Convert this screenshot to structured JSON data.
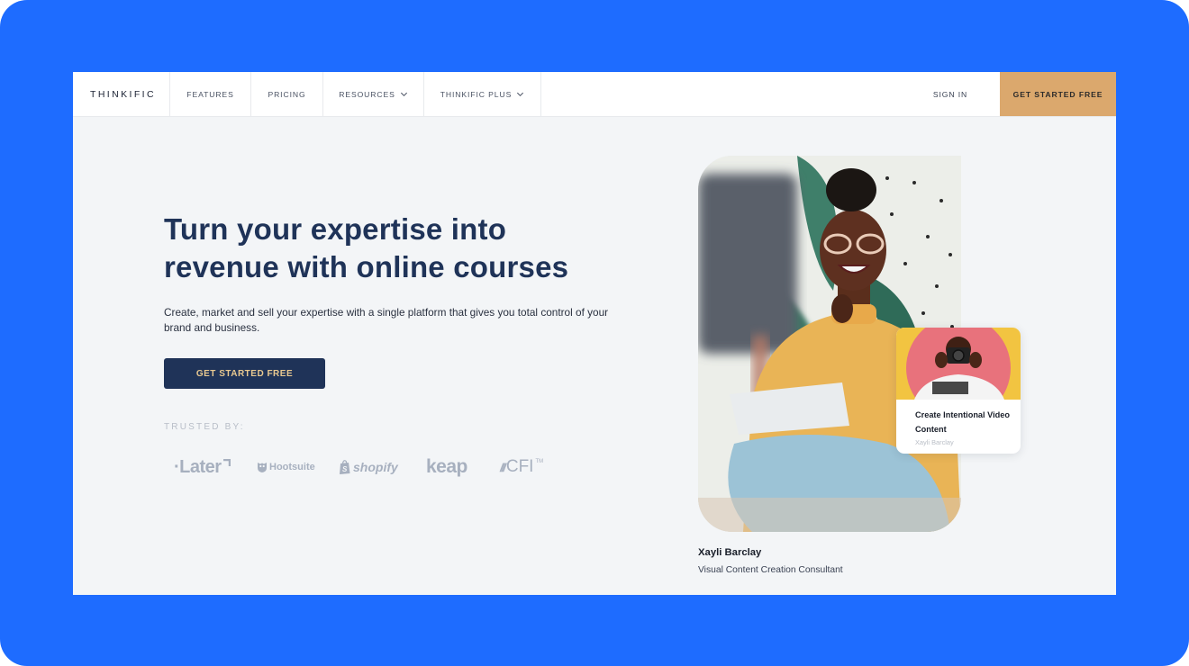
{
  "nav": {
    "logo": "THINKIFIC",
    "items": [
      {
        "label": "FEATURES",
        "has_dropdown": false
      },
      {
        "label": "PRICING",
        "has_dropdown": false
      },
      {
        "label": "RESOURCES",
        "has_dropdown": true
      },
      {
        "label": "THINKIFIC PLUS",
        "has_dropdown": true
      }
    ],
    "sign_in": "SIGN IN",
    "cta": "GET STARTED FREE"
  },
  "hero": {
    "headline_line1": "Turn your expertise into",
    "headline_line2": "revenue with online courses",
    "subtext": "Create, market and sell your expertise with a single platform that gives you total control of your brand and business.",
    "cta": "GET STARTED FREE",
    "trusted_label": "TRUSTED BY:",
    "trusted_logos": [
      {
        "name": "later",
        "text": "·Later"
      },
      {
        "name": "hootsuite",
        "text": "Hootsuite"
      },
      {
        "name": "shopify",
        "text": "shopify"
      },
      {
        "name": "keap",
        "text": "keap"
      },
      {
        "name": "cfi",
        "text": "CFI",
        "mark": "///",
        "tm": "TM"
      }
    ]
  },
  "feature": {
    "card_title": "Create Intentional Video Content",
    "card_author": "Xayli Barclay",
    "person_name": "Xayli Barclay",
    "person_role": "Visual Content Creation Consultant"
  },
  "colors": {
    "frame_bg": "#1e6cff",
    "page_bg": "#f3f5f7",
    "navy": "#1f3358",
    "gold": "#dba86d",
    "cta_text": "#e9c990",
    "logo_gray": "#a7b0bf"
  }
}
